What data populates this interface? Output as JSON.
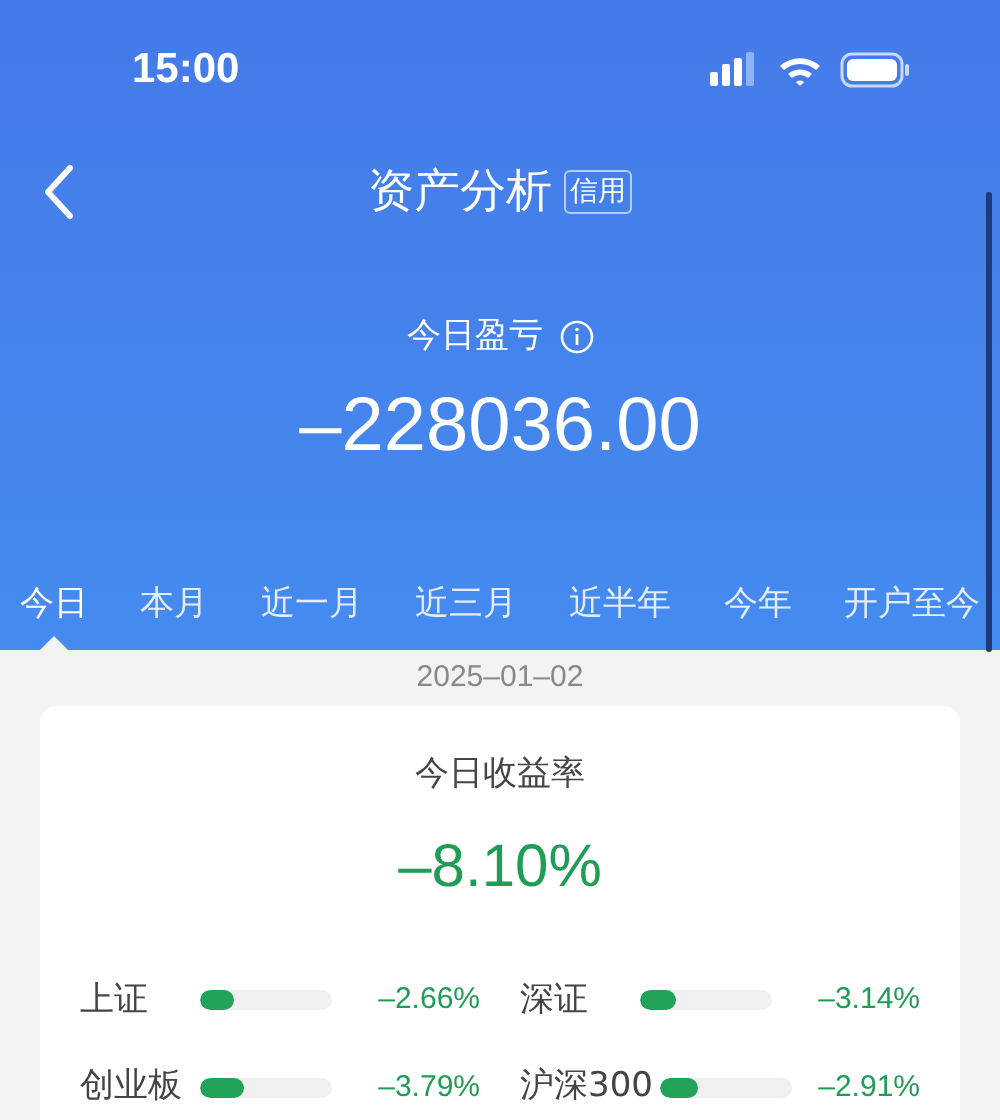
{
  "status_bar": {
    "time": "15:00"
  },
  "header": {
    "title": "资产分析",
    "badge": "信用"
  },
  "summary": {
    "label": "今日盈亏",
    "amount": "–228036.00"
  },
  "tabs": [
    {
      "label": "今日",
      "selected": true
    },
    {
      "label": "本月",
      "selected": false
    },
    {
      "label": "近一月",
      "selected": false
    },
    {
      "label": "近三月",
      "selected": false
    },
    {
      "label": "近半年",
      "selected": false
    },
    {
      "label": "今年",
      "selected": false
    },
    {
      "label": "开户至今",
      "selected": false
    }
  ],
  "date": "2025–01–02",
  "card": {
    "title": "今日收益率",
    "rate": "–8.10%",
    "indices": [
      {
        "name": "上证",
        "level": 0.25,
        "change": "–2.66%"
      },
      {
        "name": "深证",
        "level": 0.28,
        "change": "–3.14%"
      },
      {
        "name": "创业板",
        "level": 0.33,
        "change": "–3.79%"
      },
      {
        "name": "沪深300",
        "level": 0.28,
        "change": "–2.91%"
      }
    ]
  }
}
